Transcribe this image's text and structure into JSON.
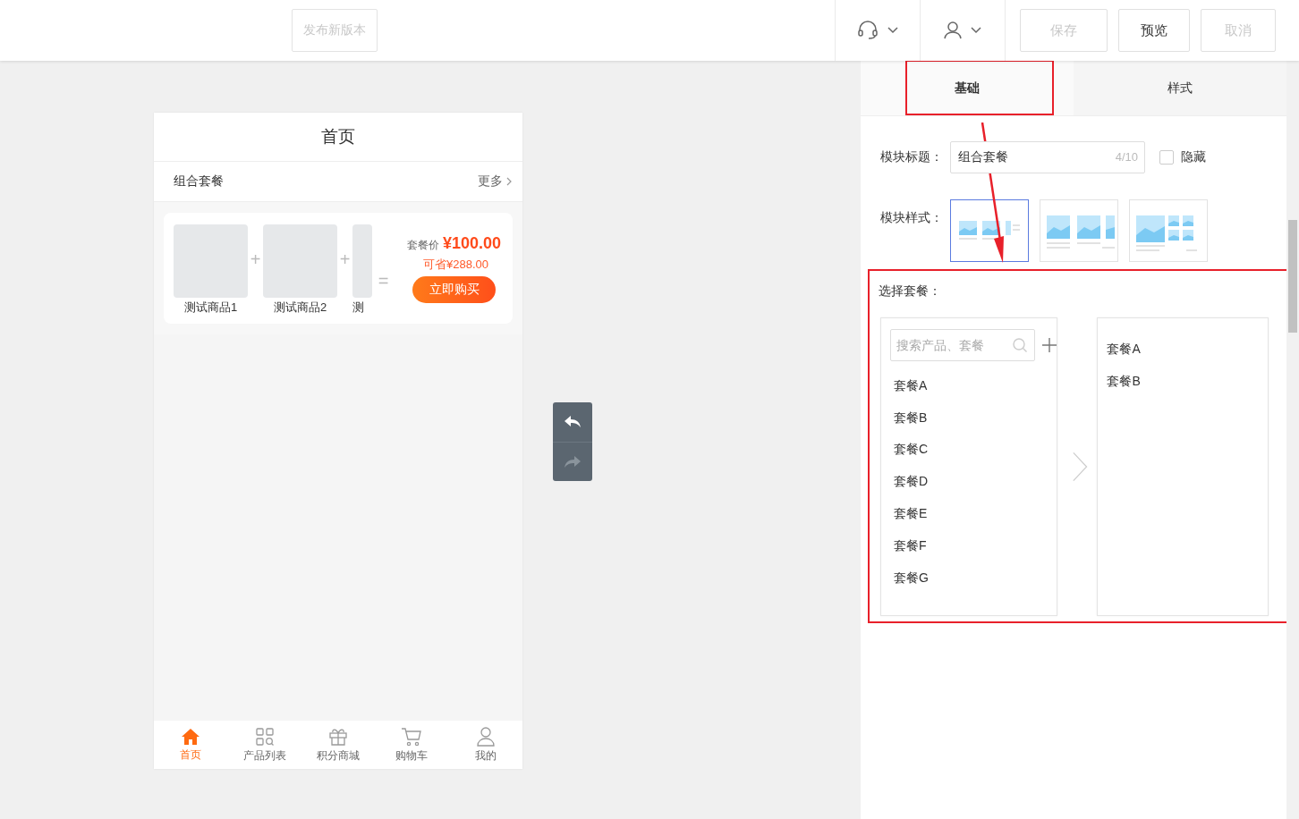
{
  "toolbar": {
    "publish_button": {
      "label": "发布新版本",
      "disabled": true
    },
    "buttons": [
      {
        "label": "保存",
        "disabled": true
      },
      {
        "label": "预览",
        "disabled": false
      },
      {
        "label": "取消",
        "disabled": true
      }
    ]
  },
  "phone": {
    "title": "首页",
    "section": {
      "title": "组合套餐",
      "more": "更多"
    },
    "bundle": {
      "products": [
        {
          "name": "测试商品1",
          "joiner": "+"
        },
        {
          "name": "测试商品2",
          "joiner": "+"
        },
        {
          "name": "测",
          "joiner": "="
        }
      ],
      "price_label": "套餐价",
      "price": "¥100.00",
      "savings": "可省¥288.00",
      "buy_button": "立即购买"
    },
    "nav": [
      {
        "label": "首页",
        "selected": true
      },
      {
        "label": "产品列表",
        "selected": false
      },
      {
        "label": "积分商城",
        "selected": false
      },
      {
        "label": "购物车",
        "selected": false
      },
      {
        "label": "我的",
        "selected": false
      }
    ]
  },
  "panel": {
    "tabs": [
      {
        "label": "基础",
        "selected": true
      },
      {
        "label": "样式",
        "selected": false
      }
    ],
    "title_field": {
      "label": "模块标题：",
      "value": "组合套餐",
      "counter": "4/10"
    },
    "hide_checkbox": {
      "label": "隐藏",
      "checked": false
    },
    "style_picker": {
      "label": "模块样式：",
      "options": [
        {
          "kind": "row",
          "selected": true
        },
        {
          "kind": "wide",
          "selected": false
        },
        {
          "kind": "grid",
          "selected": false
        }
      ]
    },
    "package_picker": {
      "label": "选择套餐：",
      "search": {
        "placeholder": "搜索产品、套餐"
      },
      "available": [
        "套餐A",
        "套餐B",
        "套餐C",
        "套餐D",
        "套餐E",
        "套餐F",
        "套餐G"
      ],
      "chosen": [
        "套餐A",
        "套餐B"
      ]
    }
  }
}
